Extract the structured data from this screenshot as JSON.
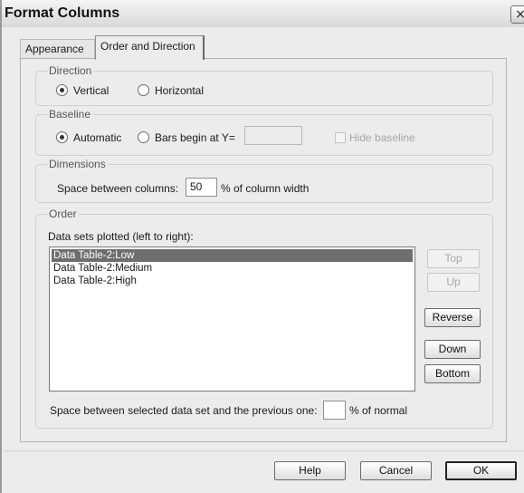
{
  "window": {
    "title": "Format Columns",
    "close_label": "×"
  },
  "tabs": [
    {
      "label": "Appearance",
      "active": false
    },
    {
      "label": "Order and Direction",
      "active": true
    }
  ],
  "direction": {
    "legend": "Direction",
    "options": [
      {
        "label": "Vertical",
        "selected": true
      },
      {
        "label": "Horizontal",
        "selected": false
      }
    ]
  },
  "baseline": {
    "legend": "Baseline",
    "options": [
      {
        "label": "Automatic",
        "selected": true
      },
      {
        "label": "Bars begin at Y=",
        "selected": false
      }
    ],
    "y_value": "",
    "hide_label": "Hide baseline",
    "hide_checked": false
  },
  "dimensions": {
    "legend": "Dimensions",
    "space_label": "Space between columns:",
    "space_value": "50",
    "space_unit": "% of column width"
  },
  "order": {
    "legend": "Order",
    "list_label": "Data sets plotted (left to right):",
    "items": [
      {
        "label": "Data Table-2:Low",
        "selected": true
      },
      {
        "label": "Data Table-2:Medium",
        "selected": false
      },
      {
        "label": "Data Table-2:High",
        "selected": false
      }
    ],
    "buttons": {
      "top": "Top",
      "up": "Up",
      "reverse": "Reverse",
      "down": "Down",
      "bottom": "Bottom"
    },
    "gap_label": "Space between selected data set and the previous one:",
    "gap_value": "",
    "gap_unit": "% of normal"
  },
  "footer": {
    "help": "Help",
    "cancel": "Cancel",
    "ok": "OK"
  }
}
